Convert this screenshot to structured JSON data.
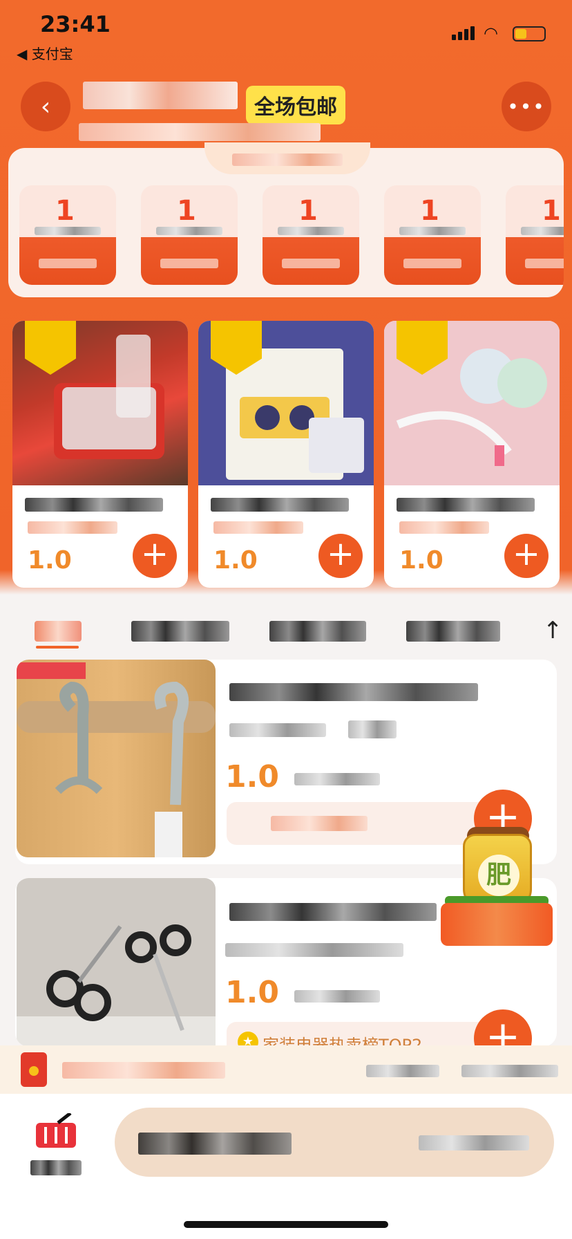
{
  "status_bar": {
    "time": "23:41",
    "back_app": "◀ 支付宝"
  },
  "header": {
    "back_icon": "‹",
    "more_icon": "•••",
    "free_shipping": "全场包邮"
  },
  "coupons": [
    {
      "amount": "1"
    },
    {
      "amount": "1"
    },
    {
      "amount": "1"
    },
    {
      "amount": "1"
    },
    {
      "amount": "1"
    }
  ],
  "products": [
    {
      "price": "1.0",
      "image": "red-storage-box"
    },
    {
      "price": "1.0",
      "image": "lens-cleaning-wipes"
    },
    {
      "price": "1.0",
      "image": "measuring-tape"
    }
  ],
  "list_items": [
    {
      "price": "1.0",
      "image": "rotating-hook"
    },
    {
      "price": "1.0",
      "image": "scissors",
      "hot_text": "家装电器热卖榜TOP2"
    }
  ],
  "fertilizer": {
    "label": "肥"
  },
  "icons": {
    "plus": "+",
    "up": "↑",
    "star": "★"
  },
  "colors": {
    "brand_orange": "#f26a2c",
    "price_orange": "#f08a2a",
    "badge_yellow": "#ffe14a"
  }
}
